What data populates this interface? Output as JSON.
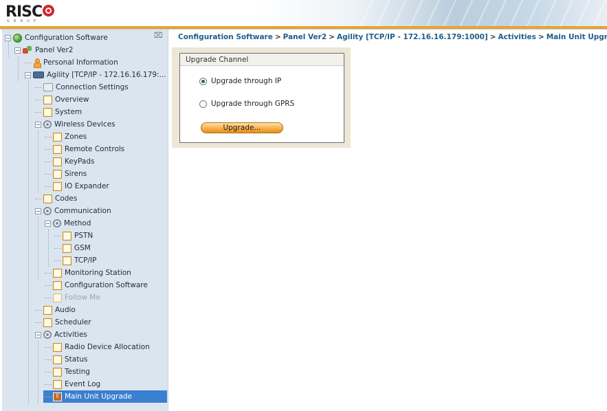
{
  "app": {
    "logo_text": "RISC",
    "logo_sub": "GROUP"
  },
  "breadcrumb": [
    "Configuration Software",
    "Panel Ver2",
    "Agility [TCP/IP - 172.16.16.179:1000]",
    "Activities",
    "Main Unit Upgrade"
  ],
  "tree": {
    "collapse_glyph": "⌕",
    "items": [
      {
        "label": "Configuration Software",
        "icon": "globe-icon",
        "expander": "-"
      },
      {
        "label": "Panel Ver2",
        "icon": "panel-icon",
        "expander": "-"
      },
      {
        "label": "Personal Information",
        "icon": "person-icon"
      },
      {
        "label": "Agility [TCP/IP - 172.16.16.179:...",
        "icon": "device-icon",
        "expander": "-"
      },
      {
        "label": "Connection Settings",
        "icon": "connection-icon"
      },
      {
        "label": "Overview",
        "icon": "folder-icon"
      },
      {
        "label": "System",
        "icon": "folder-icon"
      },
      {
        "label": "Wireless Devices",
        "icon": "gear-icon",
        "expander": "-"
      },
      {
        "label": "Zones",
        "icon": "folder-icon"
      },
      {
        "label": "Remote Controls",
        "icon": "folder-icon"
      },
      {
        "label": "KeyPads",
        "icon": "folder-icon"
      },
      {
        "label": "Sirens",
        "icon": "folder-icon"
      },
      {
        "label": "IO Expander",
        "icon": "folder-icon"
      },
      {
        "label": "Codes",
        "icon": "folder-icon"
      },
      {
        "label": "Communication",
        "icon": "gear-icon",
        "expander": "-"
      },
      {
        "label": "Method",
        "icon": "gear-icon",
        "expander": "-"
      },
      {
        "label": "PSTN",
        "icon": "folder-icon"
      },
      {
        "label": "GSM",
        "icon": "folder-icon"
      },
      {
        "label": "TCP/IP",
        "icon": "folder-icon"
      },
      {
        "label": "Monitoring Station",
        "icon": "folder-icon"
      },
      {
        "label": "Configuration Software",
        "icon": "folder-icon"
      },
      {
        "label": "Follow Me",
        "icon": "folder-icon",
        "disabled": true
      },
      {
        "label": "Audio",
        "icon": "folder-icon"
      },
      {
        "label": "Scheduler",
        "icon": "folder-icon"
      },
      {
        "label": "Activities",
        "icon": "gear-icon",
        "expander": "-"
      },
      {
        "label": "Radio Device Allocation",
        "icon": "folder-icon"
      },
      {
        "label": "Status",
        "icon": "folder-icon"
      },
      {
        "label": "Testing",
        "icon": "folder-icon"
      },
      {
        "label": "Event Log",
        "icon": "folder-icon"
      },
      {
        "label": "Main Unit Upgrade",
        "icon": "upgrade-icon",
        "selected": true
      }
    ]
  },
  "upgrade_channel": {
    "title": "Upgrade Channel",
    "options": [
      {
        "label": "Upgrade through IP",
        "checked": true
      },
      {
        "label": "Upgrade through GPRS",
        "checked": false
      }
    ],
    "button_label": "Upgrade..."
  },
  "colors": {
    "accent_orange": "#e9a22e",
    "breadcrumb_blue": "#1f5d8a",
    "selection_blue": "#3a7fd0",
    "tree_bg": "#dbe5f0"
  }
}
